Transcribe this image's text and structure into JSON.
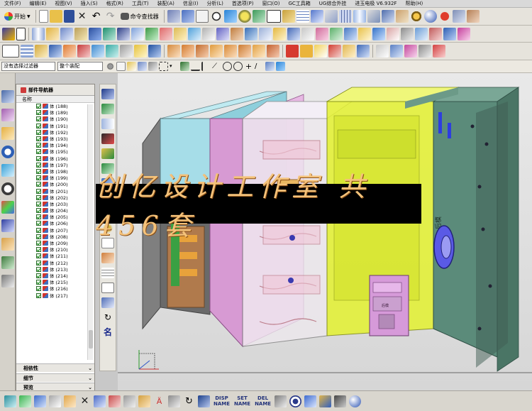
{
  "menubar": {
    "items": [
      "文件(F)",
      "编辑(E)",
      "视图(V)",
      "插入(S)",
      "格式(R)",
      "工具(T)",
      "装配(A)",
      "信息(I)",
      "分析(L)",
      "首选项(P)",
      "窗口(O)",
      "GC工具箱",
      "UG综合外挂",
      "进玉电极 V6.932F",
      "帮助(H)"
    ]
  },
  "toolbar": {
    "start_label": "开始",
    "command_finder_label": "命令查找器",
    "selection_filter": "没有选择过滤器",
    "selection_scope": "整个装配"
  },
  "navigator": {
    "title": "部件导航器",
    "column_header": "名称",
    "items": [
      "体 (188)",
      "体 (189)",
      "体 (190)",
      "体 (191)",
      "体 (192)",
      "体 (193)",
      "体 (194)",
      "体 (195)",
      "体 (196)",
      "体 (197)",
      "体 (198)",
      "体 (199)",
      "体 (200)",
      "体 (201)",
      "体 (202)",
      "体 (203)",
      "体 (204)",
      "体 (205)",
      "体 (206)",
      "体 (207)",
      "体 (208)",
      "体 (209)",
      "体 (210)",
      "体 (211)",
      "体 (212)",
      "体 (213)",
      "体 (214)",
      "体 (215)",
      "体 (216)",
      "体 (217)"
    ],
    "panels": [
      "相依性",
      "细节",
      "预览"
    ]
  },
  "viewport": {
    "banner_text": "创亿设计工作室 共456套",
    "model_label_1": "前模",
    "model_label_2": "后模",
    "model_label_3": "后模"
  },
  "statusbar": {
    "buttons": [
      {
        "top": "DISP",
        "bottom": "NAME"
      },
      {
        "top": "SET",
        "bottom": "NAME"
      },
      {
        "top": "DEL",
        "bottom": "NAME"
      }
    ]
  },
  "colors": {
    "cyan_plate": "#a6dde8",
    "pink_plate": "#d79ad3",
    "yellow_core": "#e4f230",
    "gray_plate": "#5b8b7a",
    "banner_bg": "#000000",
    "banner_text": "#f4c27a"
  }
}
